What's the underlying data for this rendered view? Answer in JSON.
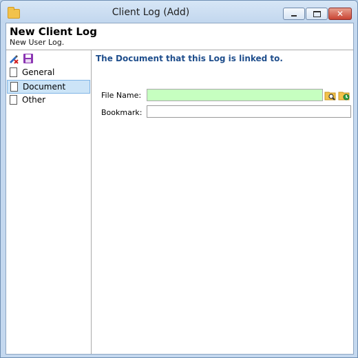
{
  "window": {
    "title": "Client Log (Add)",
    "controls": {
      "minimize": "minimize",
      "maximize": "maximize",
      "close": "close"
    }
  },
  "header": {
    "title": "New Client Log",
    "subtitle": "New User Log."
  },
  "sidebar": {
    "tools": [
      "clear-icon",
      "save-icon"
    ],
    "items": [
      {
        "label": "General"
      },
      {
        "label": "Document"
      },
      {
        "label": "Other"
      }
    ],
    "selected": "Document"
  },
  "document_panel": {
    "section_title": "The Document that this Log is linked to.",
    "file_name_label": "File Name:",
    "file_name_value": "",
    "bookmark_label": "Bookmark:",
    "bookmark_value": ""
  },
  "colors": {
    "accent": "#1f4e8c",
    "selected_bg": "#cce4f7",
    "file_field_bg": "#c6ffc0"
  }
}
